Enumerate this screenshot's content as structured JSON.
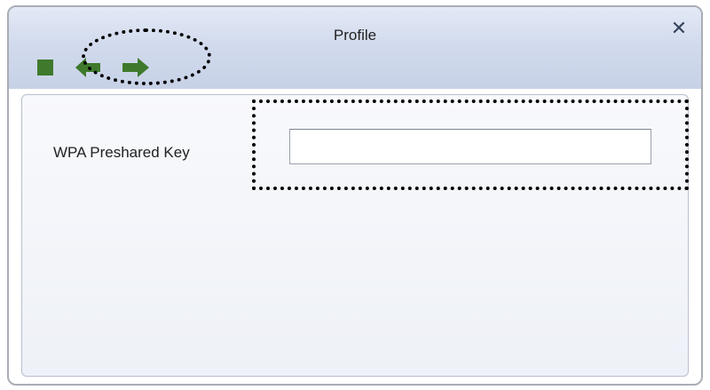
{
  "window": {
    "title": "Profile",
    "close_symbol": "✕"
  },
  "toolbar": {
    "icons": [
      "stop-icon",
      "back-arrow-icon",
      "forward-arrow-icon"
    ],
    "icon_color": "#3f7a2c"
  },
  "form": {
    "wpa_key_label": "WPA Preshared Key",
    "wpa_key_value": "",
    "wpa_key_placeholder": ""
  },
  "annotations": {
    "highlight_color": "#000000"
  }
}
